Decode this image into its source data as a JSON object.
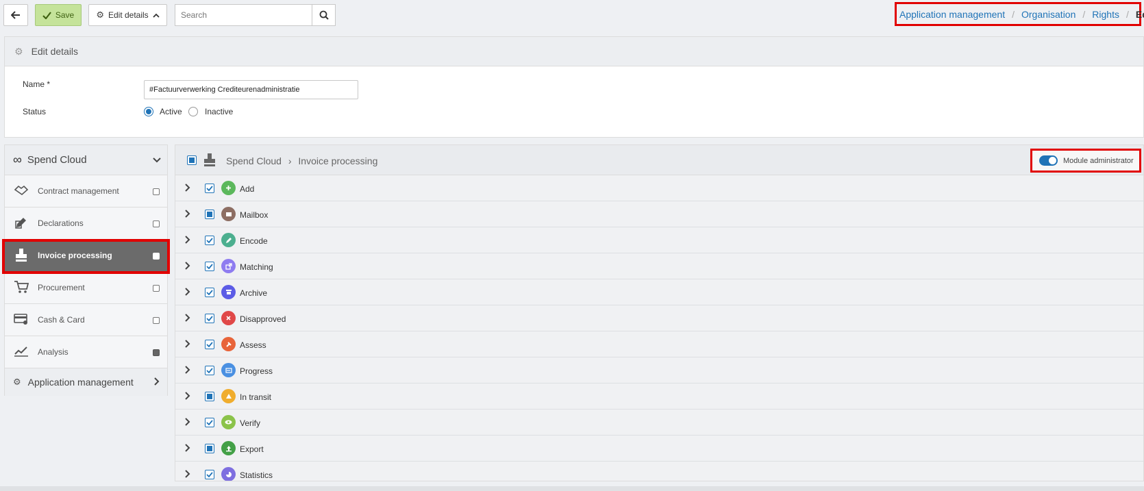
{
  "toolbar": {
    "save_label": "Save",
    "edit_label": "Edit details",
    "search_placeholder": "Search"
  },
  "breadcrumb": {
    "items": [
      "Application management",
      "Organisation",
      "Rights"
    ],
    "current": "Edit"
  },
  "details": {
    "header": "Edit details",
    "name_label": "Name *",
    "name_value": "#Factuurverwerking Crediteurenadministratie",
    "status_label": "Status",
    "status_options": [
      "Active",
      "Inactive"
    ],
    "status_selected": "Active"
  },
  "sidebar": {
    "title": "Spend Cloud",
    "items": [
      {
        "label": "Contract management",
        "icon": "handshake-icon"
      },
      {
        "label": "Declarations",
        "icon": "edit-icon"
      },
      {
        "label": "Invoice processing",
        "icon": "stamp-icon",
        "active": true
      },
      {
        "label": "Procurement",
        "icon": "cart-icon"
      },
      {
        "label": "Cash & Card",
        "icon": "card-icon"
      },
      {
        "label": "Analysis",
        "icon": "chart-icon",
        "filled": true
      }
    ],
    "footer": "Application management"
  },
  "module": {
    "parent": "Spend Cloud",
    "name": "Invoice processing",
    "admin_label": "Module administrator",
    "rows": [
      {
        "label": "Add",
        "state": "checked",
        "color": "#5cb85c"
      },
      {
        "label": "Mailbox",
        "state": "partial",
        "color": "#8d6e63"
      },
      {
        "label": "Encode",
        "state": "checked",
        "color": "#4caf8f"
      },
      {
        "label": "Matching",
        "state": "checked",
        "color": "#8e7cf0"
      },
      {
        "label": "Archive",
        "state": "checked",
        "color": "#5c5ce6"
      },
      {
        "label": "Disapproved",
        "state": "checked",
        "color": "#e04848"
      },
      {
        "label": "Assess",
        "state": "checked",
        "color": "#e8643a"
      },
      {
        "label": "Progress",
        "state": "checked",
        "color": "#4a90e2"
      },
      {
        "label": "In transit",
        "state": "partial",
        "color": "#f0ad2e"
      },
      {
        "label": "Verify",
        "state": "checked",
        "color": "#8bc34a"
      },
      {
        "label": "Export",
        "state": "partial",
        "color": "#43a047"
      },
      {
        "label": "Statistics",
        "state": "checked",
        "color": "#7e6fe0"
      }
    ]
  }
}
